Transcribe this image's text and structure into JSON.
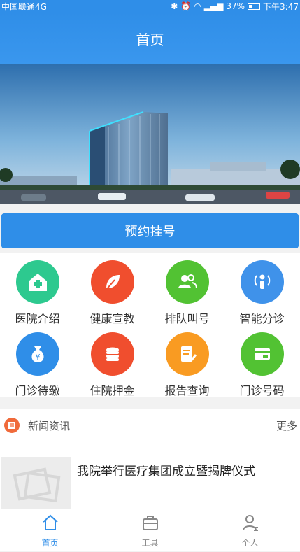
{
  "status_bar": {
    "carrier": "中国联通4G",
    "battery": "37%",
    "time": "下午3:47"
  },
  "app_bar": {
    "title": "首页"
  },
  "book_button": {
    "label": "预约挂号"
  },
  "services": [
    {
      "label": "医院介绍",
      "icon": "hospital-icon",
      "color": "#2dc98f"
    },
    {
      "label": "健康宣教",
      "icon": "leaf-icon",
      "color": "#f04e2e"
    },
    {
      "label": "排队叫号",
      "icon": "people-icon",
      "color": "#52c233"
    },
    {
      "label": "智能分诊",
      "icon": "person-signal-icon",
      "color": "#3f92ea"
    },
    {
      "label": "门诊待缴",
      "icon": "money-bag-icon",
      "color": "#2f8ee8"
    },
    {
      "label": "住院押金",
      "icon": "coins-icon",
      "color": "#f04e2e"
    },
    {
      "label": "报告查询",
      "icon": "report-icon",
      "color": "#f99b22"
    },
    {
      "label": "门诊号码",
      "icon": "card-icon",
      "color": "#52c233"
    }
  ],
  "news": {
    "title": "新闻资讯",
    "more": "更多",
    "items": [
      {
        "headline": "我院举行医疗集团成立暨揭牌仪式"
      }
    ]
  },
  "tabs": [
    {
      "label": "首页",
      "icon": "home-icon",
      "active": true
    },
    {
      "label": "工具",
      "icon": "toolbox-icon",
      "active": false
    },
    {
      "label": "个人",
      "icon": "person-icon",
      "active": false
    }
  ],
  "colors": {
    "primary": "#2f8ee8",
    "active_tab": "#2f8ee8",
    "inactive_tab": "#888888"
  }
}
